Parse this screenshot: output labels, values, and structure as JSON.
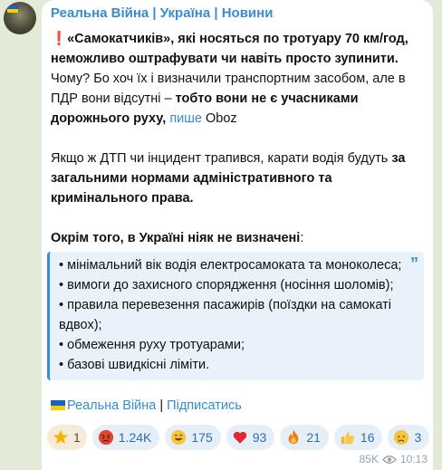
{
  "channel": {
    "name": "Реальна Війна | Україна | Новини"
  },
  "post": {
    "p1_excl": "❗️",
    "p1_bold": "«Самокатчиків», які носяться по тротуару 70 км/год, неможливо оштрафувати чи навіть просто зупинити.",
    "p1_normal": " Чому? Бо хоч їх і визначили транспортним засобом, але в ПДР вони відсутні – ",
    "p1_bold2": "тобто вони не є учасниками дорожнього руху,",
    "p1_space": " ",
    "p1_link": "пише",
    "p1_tail": " Oboz",
    "p2_normal": "Якщо ж ДТП чи інцидент трапився, карати водія будуть ",
    "p2_bold": "за загальними нормами адміністративного та кримінального права.",
    "p3_bold": "Окрім того, в Україні ніяк не визначені",
    "p3_tail": ":",
    "quote_items": [
      "• мінімальний вік водія електросамоката та моноколеса;",
      "• вимоги до захисного спорядження (носіння шоломів);",
      "• правила перевезення пасажирів (поїздки на самокаті вдвох);",
      "• обмеження руху тротуарами;",
      "• базові швидкісні ліміти."
    ]
  },
  "footer": {
    "channel_link": "Реальна Війна",
    "separator": " | ",
    "subscribe_link": "Підписатись"
  },
  "reactions": [
    {
      "icon": "star-icon",
      "count": "1"
    },
    {
      "icon": "angry-face-icon",
      "count": "1.24K"
    },
    {
      "icon": "grinning-face-icon",
      "count": "175"
    },
    {
      "icon": "heart-icon",
      "count": "93"
    },
    {
      "icon": "fire-icon",
      "count": "21"
    },
    {
      "icon": "thumbs-up-icon",
      "count": "16"
    },
    {
      "icon": "crying-face-icon",
      "count": "3"
    }
  ],
  "meta": {
    "views": "85K",
    "time": "10:13"
  },
  "colors": {
    "accent": "#3a8bd1",
    "background": "#e3ebd8",
    "bubble": "#ffffff",
    "quote_bg": "#e9f1fa"
  }
}
